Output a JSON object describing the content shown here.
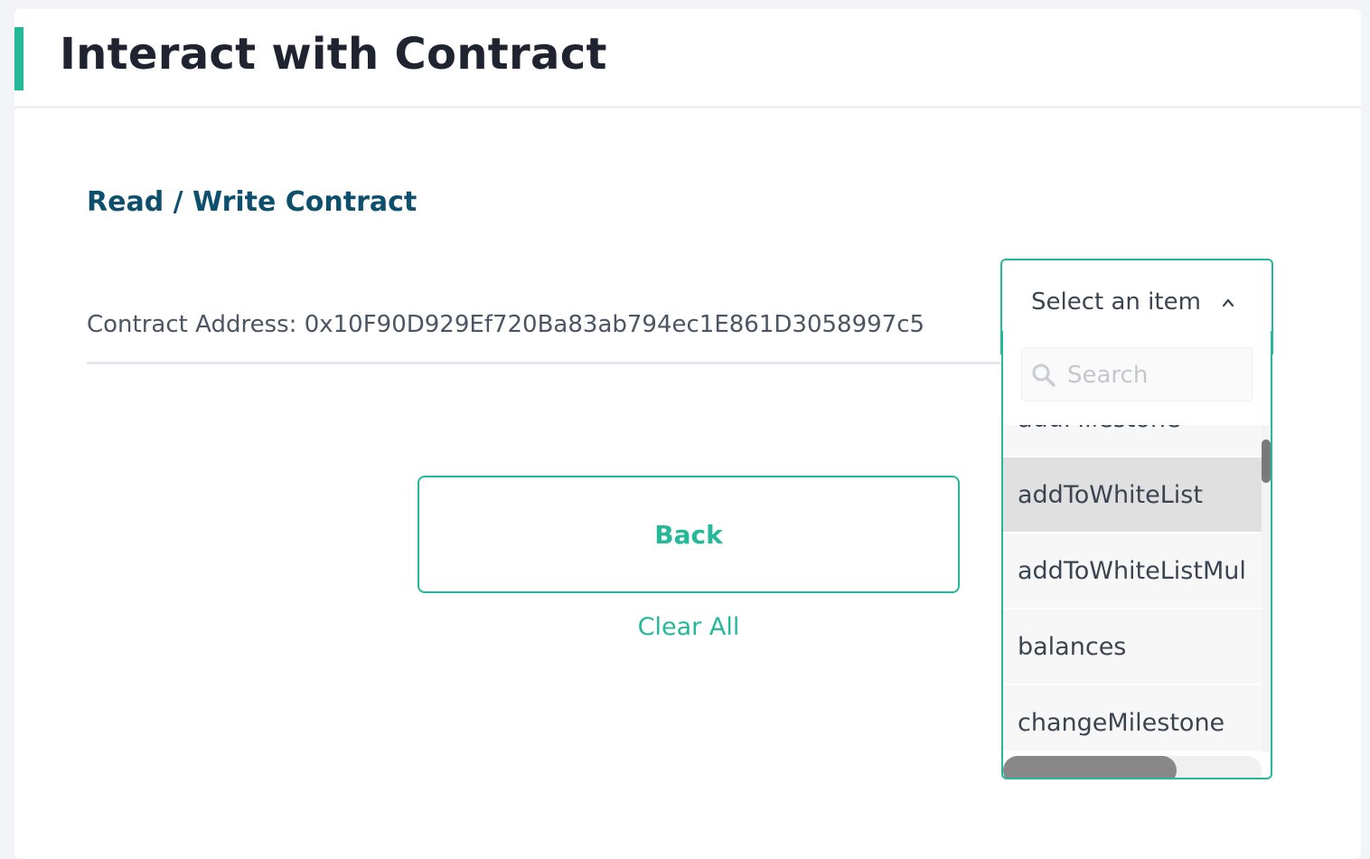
{
  "header": {
    "title": "Interact with Contract"
  },
  "section": {
    "title": "Read / Write Contract"
  },
  "contract": {
    "address_label": "Contract Address: ",
    "address_value": "0x10F90D929Ef720Ba83ab794ec1E861D3058997c5"
  },
  "actions": {
    "back_label": "Back",
    "clear_all_label": "Clear All"
  },
  "dropdown": {
    "trigger_label": "Select an item",
    "search_placeholder": "Search",
    "items": [
      "addMilestone",
      "addToWhiteList",
      "addToWhiteListMul",
      "balances",
      "changeMilestone"
    ],
    "highlighted_item": "addToWhiteList"
  },
  "colors": {
    "accent": "#25b99a",
    "section_title": "#0e4f6e",
    "header_title": "#1f2430"
  },
  "icons": {
    "chevron": "chevron-up-icon",
    "search": "search-icon"
  }
}
